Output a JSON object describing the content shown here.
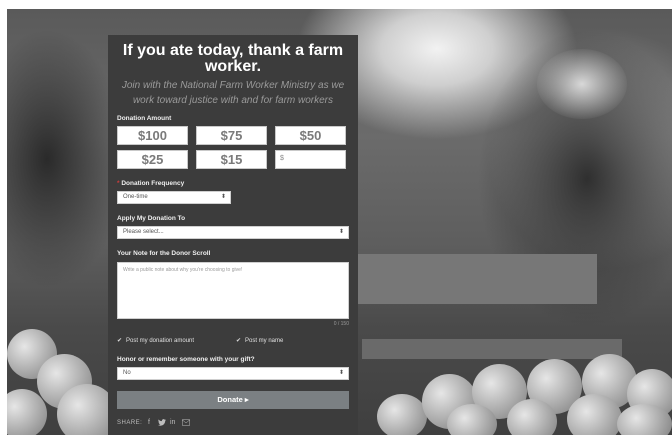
{
  "header": {
    "title": "If you ate today, thank a farm worker.",
    "subtitle": "Join with the National Farm Worker Ministry as we work toward justice with and for farm workers"
  },
  "donation": {
    "amount_label": "Donation Amount",
    "amounts": [
      "$100",
      "$75",
      "$50",
      "$25",
      "$15"
    ],
    "custom_amount_prefix": "$",
    "frequency_required_mark": "*",
    "frequency_label": "Donation Frequency",
    "frequency_value": "One-time",
    "apply_label": "Apply My Donation To",
    "apply_placeholder": "Please select...",
    "note_label": "Your Note for the Donor Scroll",
    "note_placeholder": "Write a public note about why you're choosing to give!",
    "note_counter": "0 / 150",
    "post_amount_label": "Post my donation amount",
    "post_name_label": "Post my name",
    "honor_label": "Honor or remember someone with your gift?",
    "honor_value": "No",
    "donate_label": "Donate",
    "donate_arrow": "▸"
  },
  "share": {
    "label": "SHARE:",
    "icons": [
      "facebook-icon",
      "twitter-icon",
      "linkedin-icon",
      "email-icon"
    ]
  },
  "colors": {
    "panel_bg": "#3c3c3c",
    "donate_button": "#7b8083",
    "required": "#d23b3b"
  }
}
